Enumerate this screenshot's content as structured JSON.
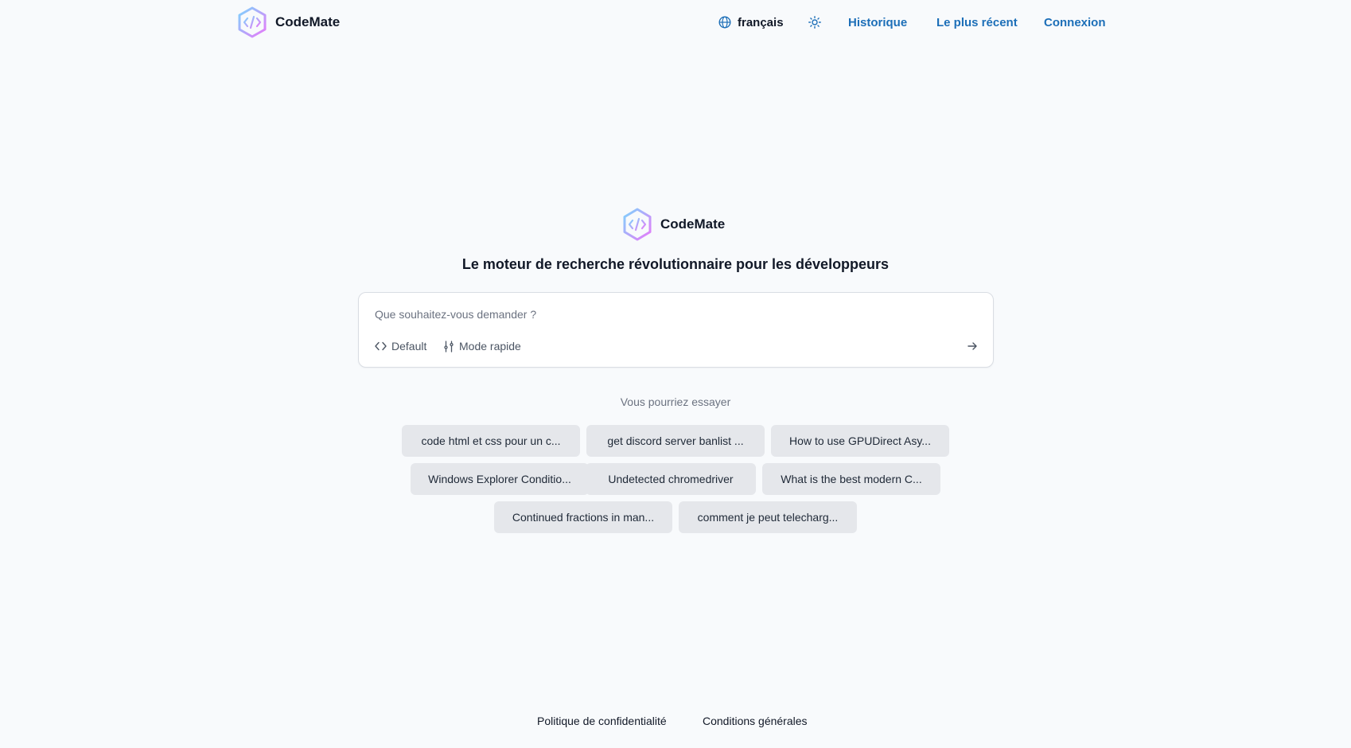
{
  "header": {
    "brand": "CodeMate",
    "language": "français",
    "links": [
      "Historique",
      "Le plus récent",
      "Connexion"
    ]
  },
  "hero": {
    "brand": "CodeMate",
    "tagline": "Le moteur de recherche révolutionnaire pour les développeurs"
  },
  "search": {
    "placeholder": "Que souhaitez-vous demander ?",
    "mode_default": "Default",
    "mode_fast": "Mode rapide"
  },
  "suggestions": {
    "label": "Vous pourriez essayer",
    "items": [
      "code html et css pour un c...",
      "get discord server banlist ...",
      "How to use GPUDirect Asy...",
      "Windows Explorer Conditio...",
      "Undetected chromedriver",
      "What is the best modern C...",
      "Continued fractions in man...",
      "comment je peut telecharg..."
    ]
  },
  "footer": {
    "privacy": "Politique de confidentialité",
    "terms": "Conditions générales"
  },
  "colors": {
    "background": "#f8fafc",
    "link": "#1d6fb8",
    "chip": "#e5e7eb"
  },
  "icons": [
    "hexagon-code-logo-icon",
    "globe-icon",
    "sun-icon",
    "code-icon",
    "sliders-icon",
    "arrow-right-icon"
  ]
}
